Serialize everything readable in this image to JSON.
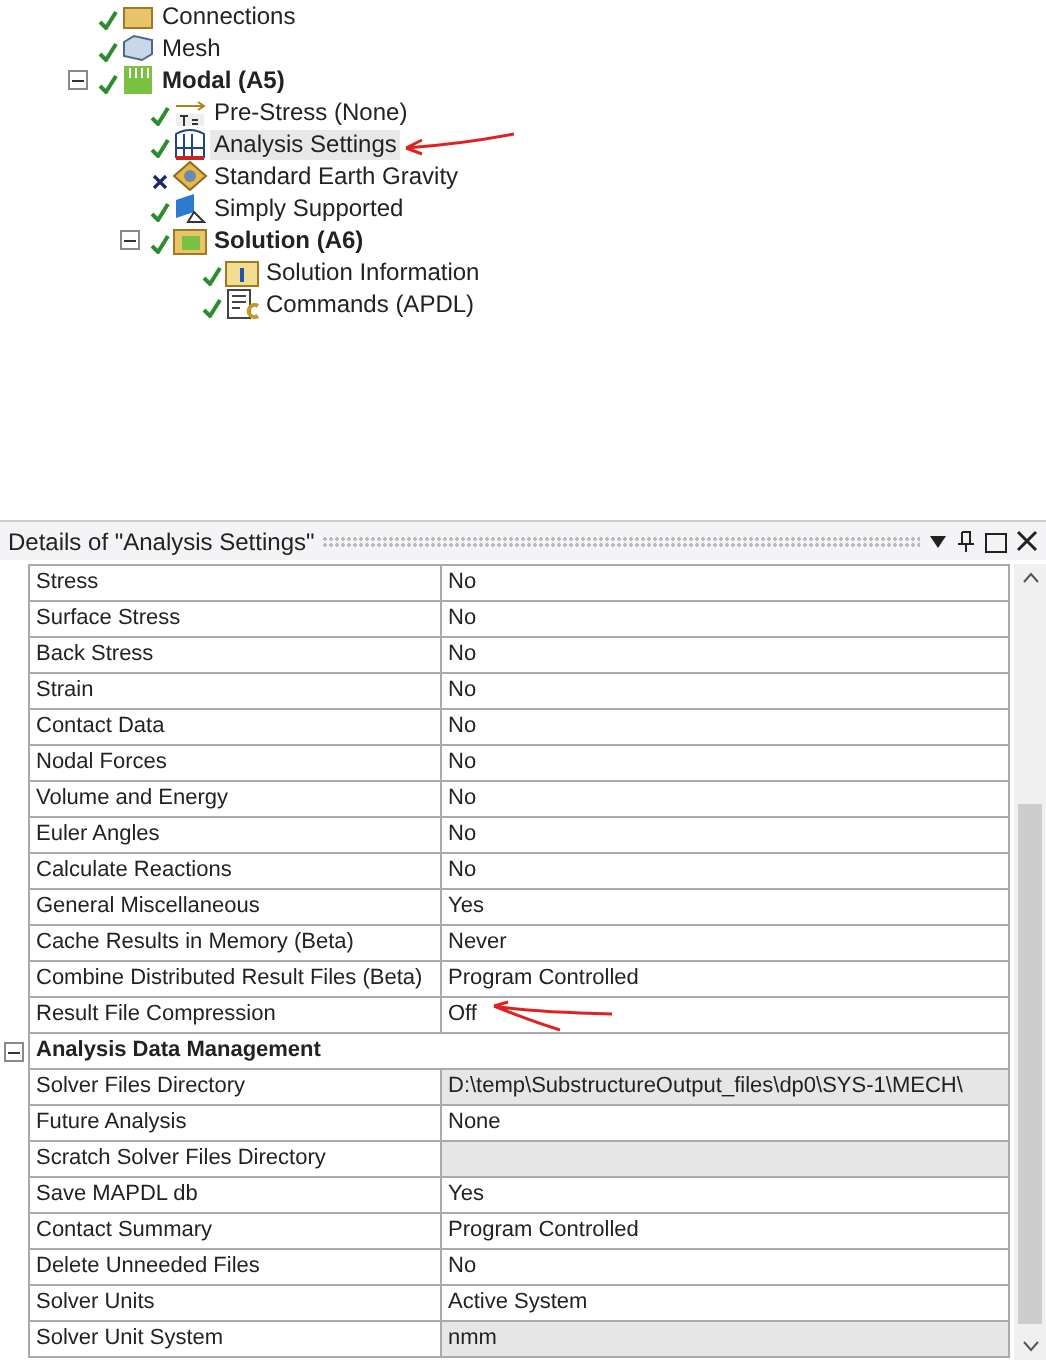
{
  "tree": [
    {
      "label": "Connections",
      "kind": "connections",
      "ok": true,
      "selected": false
    },
    {
      "label": "Mesh",
      "kind": "mesh",
      "ok": true,
      "selected": false
    },
    {
      "label": "Modal (A5)",
      "kind": "analysis",
      "ok": true,
      "selected": false,
      "expanded": true,
      "children": [
        {
          "label": "Pre-Stress (None)",
          "kind": "prestress",
          "ok": true,
          "selected": false
        },
        {
          "label": "Analysis Settings",
          "kind": "settings",
          "ok": true,
          "selected": true
        },
        {
          "label": "Standard Earth Gravity",
          "kind": "gravity",
          "ok": false,
          "selected": false
        },
        {
          "label": "Simply Supported",
          "kind": "support",
          "ok": true,
          "selected": false
        },
        {
          "label": "Solution (A6)",
          "kind": "solution",
          "ok": true,
          "selected": false,
          "expanded": true,
          "children": [
            {
              "label": "Solution Information",
              "kind": "info",
              "ok": true,
              "selected": false
            },
            {
              "label": "Commands (APDL)",
              "kind": "commands",
              "ok": true,
              "selected": false
            }
          ]
        }
      ]
    }
  ],
  "details": {
    "title": "Details of \"Analysis Settings\"",
    "rows": [
      {
        "kind": "property",
        "label": "Stress",
        "value": "No",
        "readonly": false
      },
      {
        "kind": "property",
        "label": "Surface Stress",
        "value": "No",
        "readonly": false
      },
      {
        "kind": "property",
        "label": "Back Stress",
        "value": "No",
        "readonly": false
      },
      {
        "kind": "property",
        "label": "Strain",
        "value": "No",
        "readonly": false
      },
      {
        "kind": "property",
        "label": "Contact Data",
        "value": "No",
        "readonly": false
      },
      {
        "kind": "property",
        "label": "Nodal Forces",
        "value": "No",
        "readonly": false
      },
      {
        "kind": "property",
        "label": "Volume and Energy",
        "value": "No",
        "readonly": false
      },
      {
        "kind": "property",
        "label": "Euler Angles",
        "value": "No",
        "readonly": false
      },
      {
        "kind": "property",
        "label": "Calculate Reactions",
        "value": "No",
        "readonly": false
      },
      {
        "kind": "property",
        "label": "General Miscellaneous",
        "value": "Yes",
        "readonly": false
      },
      {
        "kind": "property",
        "label": "Cache Results in Memory (Beta)",
        "value": "Never",
        "readonly": false
      },
      {
        "kind": "property",
        "label": "Combine Distributed Result Files (Beta)",
        "value": "Program Controlled",
        "readonly": false
      },
      {
        "kind": "property",
        "label": "Result File Compression",
        "value": "Off",
        "readonly": false,
        "annotated": true
      },
      {
        "kind": "category",
        "label": "Analysis Data Management",
        "expanded": true
      },
      {
        "kind": "property",
        "label": "Solver Files Directory",
        "value": "D:\\temp\\SubstructureOutput_files\\dp0\\SYS-1\\MECH\\",
        "readonly": true
      },
      {
        "kind": "property",
        "label": "Future Analysis",
        "value": "None",
        "readonly": false
      },
      {
        "kind": "property",
        "label": "Scratch Solver Files Directory",
        "value": "",
        "readonly": true
      },
      {
        "kind": "property",
        "label": "Save MAPDL db",
        "value": "Yes",
        "readonly": false
      },
      {
        "kind": "property",
        "label": "Contact Summary",
        "value": "Program Controlled",
        "readonly": false
      },
      {
        "kind": "property",
        "label": "Delete Unneeded Files",
        "value": "No",
        "readonly": false
      },
      {
        "kind": "property",
        "label": "Solver Units",
        "value": "Active System",
        "readonly": false
      },
      {
        "kind": "property",
        "label": "Solver Unit System",
        "value": "nmm",
        "readonly": true
      }
    ]
  }
}
